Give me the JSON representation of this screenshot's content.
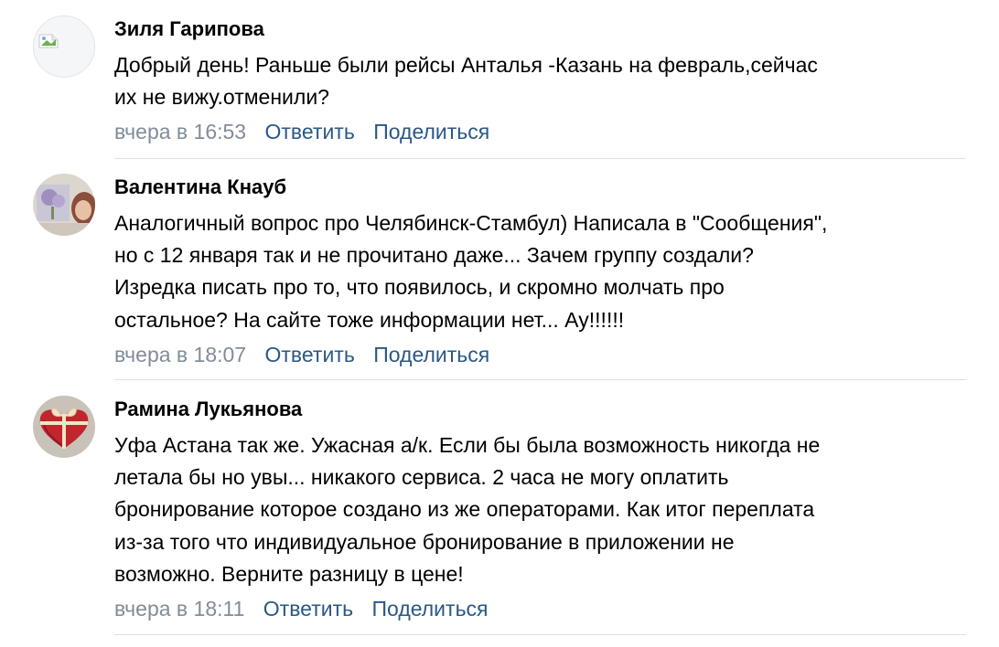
{
  "comments": [
    {
      "author": "Зиля Гарипова",
      "text_lines": [
        "Добрый день! Раньше были рейсы Анталья -Казань на февраль,сейчас",
        "их не вижу.отменили?"
      ],
      "date": "вчера в 16:53",
      "reply_label": "Ответить",
      "share_label": "Поделиться"
    },
    {
      "author": "Валентина Кнауб",
      "text_lines": [
        "Аналогичный вопрос про Челябинск-Стамбул) Написала в \"Сообщения\",",
        "но с 12 января так и не прочитано даже... Зачем группу создали?",
        "Изредка писать про то, что появилось, и скромно молчать про",
        "остальное? На сайте тоже информации нет... Ау!!!!!!"
      ],
      "date": "вчера в 18:07",
      "reply_label": "Ответить",
      "share_label": "Поделиться"
    },
    {
      "author": "Рамина Лукьянова",
      "text_lines": [
        "Уфа Астана так же. Ужасная а/к. Если бы была возможность никогда не",
        "летала бы но увы... никакого сервиса. 2 часа не могу оплатить",
        "бронирование которое создано из же операторами. Как итог переплата",
        "из-за того что индивидуальное бронирование в приложении не",
        "возможно. Верните разницу в цене!"
      ],
      "date": "вчера в 18:11",
      "reply_label": "Ответить",
      "share_label": "Поделиться"
    }
  ],
  "colors": {
    "author": "#000000",
    "text": "#000000",
    "date": "#818c99",
    "action_link": "#2a5885",
    "separator": "#dce1e6"
  }
}
